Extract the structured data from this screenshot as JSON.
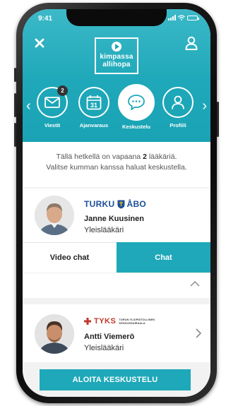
{
  "status": {
    "time": "9:41"
  },
  "logo": {
    "line1": "kimpassa",
    "line2": "allihopa"
  },
  "nav": {
    "items": [
      {
        "label": "Viestit",
        "icon": "envelope-icon",
        "badge": "2"
      },
      {
        "label": "Ajanvaraus",
        "icon": "calendar-icon",
        "date": "31"
      },
      {
        "label": "Keskustelu",
        "icon": "chat-bubble-icon",
        "active": true
      },
      {
        "label": "Profiili",
        "icon": "person-icon"
      }
    ]
  },
  "info": {
    "text_before": "Tällä hetkellä on vapaana ",
    "count": "2",
    "text_after": " lääkäriä.",
    "line2": "Valitse kumman kanssa haluat keskustella."
  },
  "doctors": [
    {
      "org": "TURKU",
      "org_suffix": "ÅBO",
      "name": "Janne Kuusinen",
      "title": "Yleislääkäri"
    },
    {
      "org": "TYKS",
      "org_sub1": "TURUN YLIOPISTOLLINEN",
      "org_sub2": "KESKUSSAIRAALA",
      "name": "Antti Viemerö",
      "title": "Yleislääkäri"
    }
  ],
  "tabs": {
    "video": "Video chat",
    "chat": "Chat"
  },
  "cta": {
    "label": "ALOITA KESKUSTELU"
  },
  "colors": {
    "accent": "#1ea8b9",
    "turku_blue": "#1d4f9a",
    "tyks_red": "#c0392b"
  }
}
